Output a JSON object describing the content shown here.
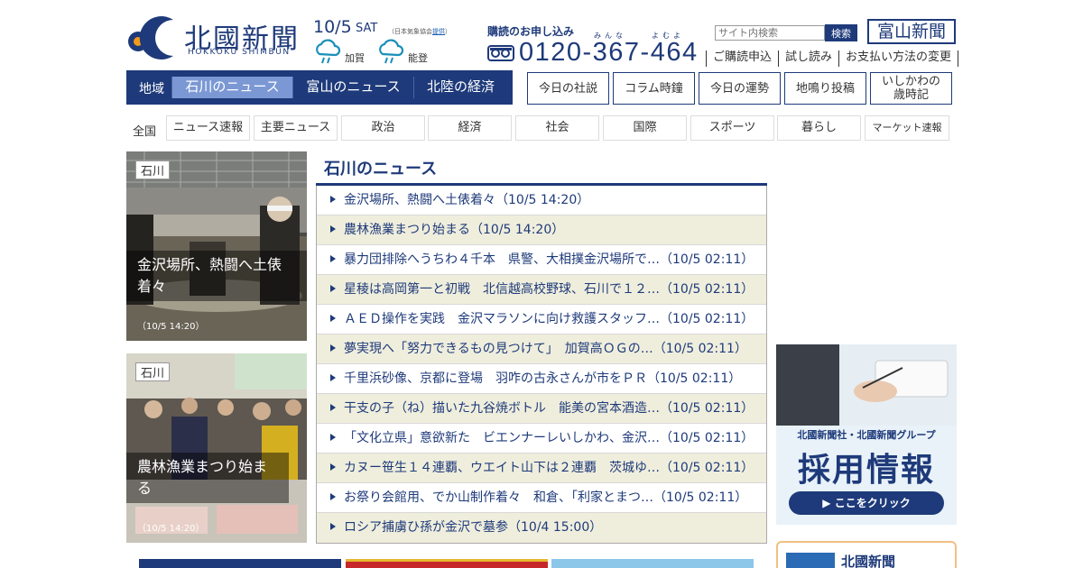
{
  "logo": {
    "title": "北國新聞",
    "subtitle": "HOKKOKU SHIMBUN"
  },
  "date": {
    "value": "10/5",
    "day": "SAT"
  },
  "weather": {
    "source_prefix": "（日本気象協会",
    "source_link": "提供",
    "source_suffix": "）",
    "areas": [
      {
        "name": "加賀",
        "icon": "cloud-rain-icon"
      },
      {
        "name": "能登",
        "icon": "cloud-rain-icon"
      }
    ]
  },
  "subscribe": {
    "label": "購読のお申し込み",
    "ruby_left": "みんな",
    "ruby_right": "よむよ",
    "phone": "0120-367-464",
    "phone_icon": "free-dial-icon"
  },
  "search": {
    "placeholder": "サイト内検索",
    "button": "検索"
  },
  "toyama_button": "富山新聞",
  "header_links": [
    "ご購読申込",
    "試し読み",
    "お支払い方法の変更"
  ],
  "region_nav": {
    "label": "地域",
    "tabs": [
      "石川のニュース",
      "富山のニュース",
      "北陸の経済"
    ],
    "active": 0
  },
  "quick_buttons": [
    "今日の社説",
    "コラム時鐘",
    "今日の運勢",
    "地鳴り投稿",
    "いしかわの",
    "歳時記"
  ],
  "categories": {
    "first": "全国",
    "items": [
      "ニュース速報",
      "主要ニュース",
      "政治",
      "経済",
      "社会",
      "国際",
      "スポーツ",
      "暮らし",
      "マーケット速報"
    ]
  },
  "photos": [
    {
      "tag": "石川",
      "caption": "金沢場所、熱闘へ土俵着々",
      "time": "（10/5 14:20）"
    },
    {
      "tag": "石川",
      "caption": "農林漁業まつり始まる",
      "time": "（10/5 14:20）"
    }
  ],
  "news": {
    "title": "石川のニュース",
    "items": [
      "金沢場所、熱闘へ土俵着々（10/5 14:20）",
      "農林漁業まつり始まる（10/5 14:20）",
      "暴力団排除へうちわ４千本　県警、大相撲金沢場所で…（10/5 02:11）",
      "星稜は高岡第一と初戦　北信越高校野球、石川で１２…（10/5 02:11）",
      "ＡＥＤ操作を実践　金沢マラソンに向け救護スタッフ…（10/5 02:11）",
      "夢実現へ「努力できるもの見つけて」　加賀高ＯＧの…（10/5 02:11）",
      "千里浜砂像、京都に登場　羽咋の古永さんが市をＰＲ（10/5 02:11）",
      "干支の子（ね）描いた九谷焼ボトル　能美の宮本酒造…（10/5 02:11）",
      "「文化立県」意欲新た　ビエンナーレいしかわ、金沢…（10/5 02:11）",
      "カヌー笹生１４連覇、ウエイト山下は２連覇　茨城ゆ…（10/5 02:11）",
      "お祭り会館用、でか山制作着々　和倉、「利家とまつ…（10/5 02:11）",
      "ロシア捕虜ひ孫が金沢で墓参（10/4 15:00）"
    ]
  },
  "ad_recruit": {
    "line1": "北國新聞社・北國新聞グループ",
    "line2": "採用情報",
    "button": "▶ ここをクリック"
  },
  "ad_second": {
    "title": "北國新聞"
  },
  "colors": {
    "navy": "#1e3a7a",
    "active_tab": "#7b98d4",
    "stripe": "#efeedd"
  }
}
